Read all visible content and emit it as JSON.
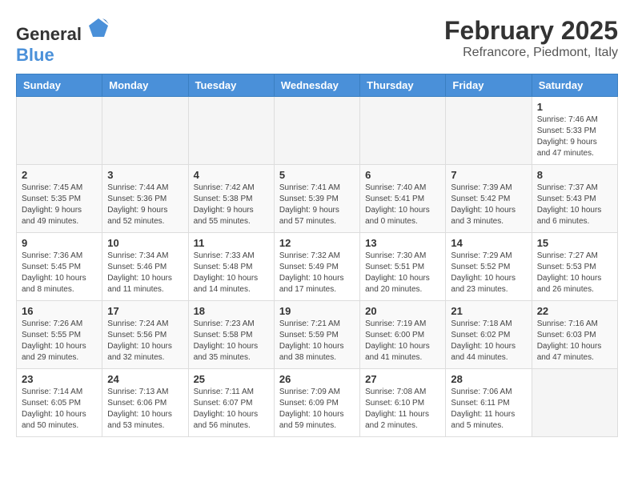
{
  "logo": {
    "general": "General",
    "blue": "Blue"
  },
  "title": "February 2025",
  "subtitle": "Refrancore, Piedmont, Italy",
  "days_of_week": [
    "Sunday",
    "Monday",
    "Tuesday",
    "Wednesday",
    "Thursday",
    "Friday",
    "Saturday"
  ],
  "weeks": [
    [
      {
        "day": "",
        "info": ""
      },
      {
        "day": "",
        "info": ""
      },
      {
        "day": "",
        "info": ""
      },
      {
        "day": "",
        "info": ""
      },
      {
        "day": "",
        "info": ""
      },
      {
        "day": "",
        "info": ""
      },
      {
        "day": "1",
        "info": "Sunrise: 7:46 AM\nSunset: 5:33 PM\nDaylight: 9 hours and 47 minutes."
      }
    ],
    [
      {
        "day": "2",
        "info": "Sunrise: 7:45 AM\nSunset: 5:35 PM\nDaylight: 9 hours and 49 minutes."
      },
      {
        "day": "3",
        "info": "Sunrise: 7:44 AM\nSunset: 5:36 PM\nDaylight: 9 hours and 52 minutes."
      },
      {
        "day": "4",
        "info": "Sunrise: 7:42 AM\nSunset: 5:38 PM\nDaylight: 9 hours and 55 minutes."
      },
      {
        "day": "5",
        "info": "Sunrise: 7:41 AM\nSunset: 5:39 PM\nDaylight: 9 hours and 57 minutes."
      },
      {
        "day": "6",
        "info": "Sunrise: 7:40 AM\nSunset: 5:41 PM\nDaylight: 10 hours and 0 minutes."
      },
      {
        "day": "7",
        "info": "Sunrise: 7:39 AM\nSunset: 5:42 PM\nDaylight: 10 hours and 3 minutes."
      },
      {
        "day": "8",
        "info": "Sunrise: 7:37 AM\nSunset: 5:43 PM\nDaylight: 10 hours and 6 minutes."
      }
    ],
    [
      {
        "day": "9",
        "info": "Sunrise: 7:36 AM\nSunset: 5:45 PM\nDaylight: 10 hours and 8 minutes."
      },
      {
        "day": "10",
        "info": "Sunrise: 7:34 AM\nSunset: 5:46 PM\nDaylight: 10 hours and 11 minutes."
      },
      {
        "day": "11",
        "info": "Sunrise: 7:33 AM\nSunset: 5:48 PM\nDaylight: 10 hours and 14 minutes."
      },
      {
        "day": "12",
        "info": "Sunrise: 7:32 AM\nSunset: 5:49 PM\nDaylight: 10 hours and 17 minutes."
      },
      {
        "day": "13",
        "info": "Sunrise: 7:30 AM\nSunset: 5:51 PM\nDaylight: 10 hours and 20 minutes."
      },
      {
        "day": "14",
        "info": "Sunrise: 7:29 AM\nSunset: 5:52 PM\nDaylight: 10 hours and 23 minutes."
      },
      {
        "day": "15",
        "info": "Sunrise: 7:27 AM\nSunset: 5:53 PM\nDaylight: 10 hours and 26 minutes."
      }
    ],
    [
      {
        "day": "16",
        "info": "Sunrise: 7:26 AM\nSunset: 5:55 PM\nDaylight: 10 hours and 29 minutes."
      },
      {
        "day": "17",
        "info": "Sunrise: 7:24 AM\nSunset: 5:56 PM\nDaylight: 10 hours and 32 minutes."
      },
      {
        "day": "18",
        "info": "Sunrise: 7:23 AM\nSunset: 5:58 PM\nDaylight: 10 hours and 35 minutes."
      },
      {
        "day": "19",
        "info": "Sunrise: 7:21 AM\nSunset: 5:59 PM\nDaylight: 10 hours and 38 minutes."
      },
      {
        "day": "20",
        "info": "Sunrise: 7:19 AM\nSunset: 6:00 PM\nDaylight: 10 hours and 41 minutes."
      },
      {
        "day": "21",
        "info": "Sunrise: 7:18 AM\nSunset: 6:02 PM\nDaylight: 10 hours and 44 minutes."
      },
      {
        "day": "22",
        "info": "Sunrise: 7:16 AM\nSunset: 6:03 PM\nDaylight: 10 hours and 47 minutes."
      }
    ],
    [
      {
        "day": "23",
        "info": "Sunrise: 7:14 AM\nSunset: 6:05 PM\nDaylight: 10 hours and 50 minutes."
      },
      {
        "day": "24",
        "info": "Sunrise: 7:13 AM\nSunset: 6:06 PM\nDaylight: 10 hours and 53 minutes."
      },
      {
        "day": "25",
        "info": "Sunrise: 7:11 AM\nSunset: 6:07 PM\nDaylight: 10 hours and 56 minutes."
      },
      {
        "day": "26",
        "info": "Sunrise: 7:09 AM\nSunset: 6:09 PM\nDaylight: 10 hours and 59 minutes."
      },
      {
        "day": "27",
        "info": "Sunrise: 7:08 AM\nSunset: 6:10 PM\nDaylight: 11 hours and 2 minutes."
      },
      {
        "day": "28",
        "info": "Sunrise: 7:06 AM\nSunset: 6:11 PM\nDaylight: 11 hours and 5 minutes."
      },
      {
        "day": "",
        "info": ""
      }
    ]
  ]
}
